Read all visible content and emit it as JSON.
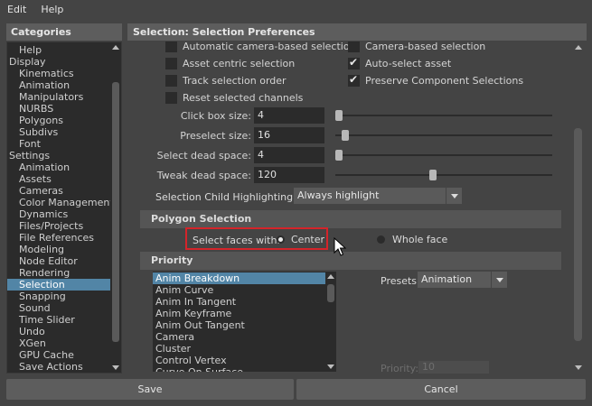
{
  "menu": {
    "edit": "Edit",
    "help": "Help"
  },
  "categories": {
    "header": "Categories",
    "items": [
      {
        "label": "Help",
        "level": 1,
        "selected": false
      },
      {
        "label": "Display",
        "level": 0,
        "selected": false
      },
      {
        "label": "Kinematics",
        "level": 1,
        "selected": false
      },
      {
        "label": "Animation",
        "level": 1,
        "selected": false
      },
      {
        "label": "Manipulators",
        "level": 1,
        "selected": false
      },
      {
        "label": "NURBS",
        "level": 1,
        "selected": false
      },
      {
        "label": "Polygons",
        "level": 1,
        "selected": false
      },
      {
        "label": "Subdivs",
        "level": 1,
        "selected": false
      },
      {
        "label": "Font",
        "level": 1,
        "selected": false
      },
      {
        "label": "Settings",
        "level": 0,
        "selected": false
      },
      {
        "label": "Animation",
        "level": 1,
        "selected": false
      },
      {
        "label": "Assets",
        "level": 1,
        "selected": false
      },
      {
        "label": "Cameras",
        "level": 1,
        "selected": false
      },
      {
        "label": "Color Management",
        "level": 1,
        "selected": false
      },
      {
        "label": "Dynamics",
        "level": 1,
        "selected": false
      },
      {
        "label": "Files/Projects",
        "level": 1,
        "selected": false
      },
      {
        "label": "File References",
        "level": 1,
        "selected": false
      },
      {
        "label": "Modeling",
        "level": 1,
        "selected": false
      },
      {
        "label": "Node Editor",
        "level": 1,
        "selected": false
      },
      {
        "label": "Rendering",
        "level": 1,
        "selected": false
      },
      {
        "label": "Selection",
        "level": 1,
        "selected": true
      },
      {
        "label": "Snapping",
        "level": 1,
        "selected": false
      },
      {
        "label": "Sound",
        "level": 1,
        "selected": false
      },
      {
        "label": "Time Slider",
        "level": 1,
        "selected": false
      },
      {
        "label": "Undo",
        "level": 1,
        "selected": false
      },
      {
        "label": "XGen",
        "level": 1,
        "selected": false
      },
      {
        "label": "GPU Cache",
        "level": 1,
        "selected": false
      },
      {
        "label": "Save Actions",
        "level": 1,
        "selected": false
      }
    ]
  },
  "prefs": {
    "header": "Selection: Selection Preferences",
    "checkboxes": {
      "auto_camera": {
        "label": "Automatic camera-based selection",
        "checked": false
      },
      "camera_based": {
        "label": "Camera-based selection",
        "checked": false
      },
      "asset_centric": {
        "label": "Asset centric selection",
        "checked": false
      },
      "auto_select_asset": {
        "label": "Auto-select asset",
        "checked": true
      },
      "track_order": {
        "label": "Track selection order",
        "checked": false
      },
      "preserve_component": {
        "label": "Preserve Component Selections",
        "checked": true
      },
      "reset_channels": {
        "label": "Reset selected channels",
        "checked": false
      }
    },
    "fields": {
      "click_box": {
        "label": "Click box size:",
        "value": "4",
        "slider": 0.0
      },
      "preselect": {
        "label": "Preselect size:",
        "value": "16",
        "slider": 0.03
      },
      "select_dead": {
        "label": "Select dead space:",
        "value": "4",
        "slider": 0.0
      },
      "tweak_dead": {
        "label": "Tweak dead space:",
        "value": "120",
        "slider": 0.45
      }
    },
    "child_highlighting": {
      "label": "Selection Child Highlighting:",
      "value": "Always highlight"
    },
    "polygon_section": {
      "title": "Polygon Selection",
      "select_faces_label": "Select faces with:",
      "center_label": "Center",
      "whole_face_label": "Whole face",
      "selected": "center"
    },
    "priority": {
      "title": "Priority",
      "items": [
        "Anim Breakdown",
        "Anim Curve",
        "Anim In Tangent",
        "Anim Keyframe",
        "Anim Out Tangent",
        "Camera",
        "Cluster",
        "Control Vertex",
        "Curve On Surface"
      ],
      "selected_index": 0,
      "presets_label": "Presets:",
      "presets_value": "Animation",
      "priority_label": "Priority:",
      "priority_value": "10"
    }
  },
  "buttons": {
    "save": "Save",
    "cancel": "Cancel"
  },
  "colors": {
    "selection": "#5285a6",
    "highlight_box": "#d4242a"
  }
}
